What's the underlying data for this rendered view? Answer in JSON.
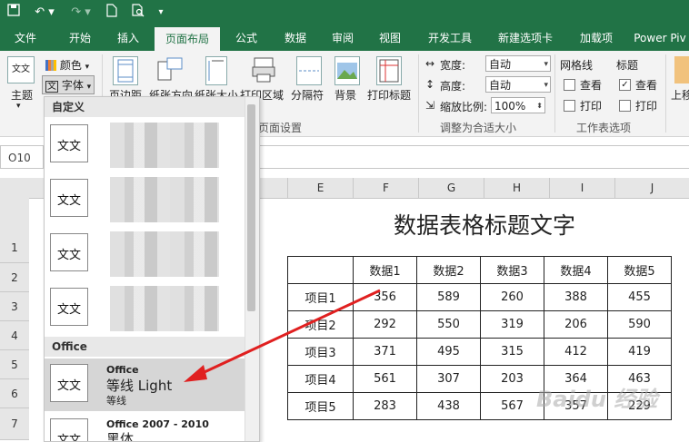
{
  "titlebar": {
    "icons": [
      "save-icon",
      "undo-icon",
      "redo-icon",
      "new-file-icon",
      "print-preview-icon",
      "customize-icon"
    ],
    "bg_color": "#217346"
  },
  "tabs": [
    {
      "label": "文件"
    },
    {
      "label": "开始"
    },
    {
      "label": "插入"
    },
    {
      "label": "页面布局",
      "active": true
    },
    {
      "label": "公式"
    },
    {
      "label": "数据"
    },
    {
      "label": "审阅"
    },
    {
      "label": "视图"
    },
    {
      "label": "开发工具"
    },
    {
      "label": "新建选项卡"
    },
    {
      "label": "加载项"
    },
    {
      "label": "Power Piv"
    }
  ],
  "ribbon": {
    "theme": {
      "main": "主题",
      "colors": "颜色",
      "fonts": "字体"
    },
    "margins": "页边距",
    "orientation": "纸张方向",
    "size": "纸张大小",
    "print_area": "打印区域",
    "breaks": "分隔符",
    "background": "背景",
    "print_titles": "打印标题",
    "page_setup_group": "页面设置",
    "scale": {
      "width_label": "宽度:",
      "width_value": "自动",
      "height_label": "高度:",
      "height_value": "自动",
      "scale_label": "缩放比例:",
      "scale_value": "100%",
      "group": "调整为合适大小"
    },
    "sheet_options": {
      "gridlines": "网格线",
      "headings": "标题",
      "view": "查看",
      "print": "打印",
      "gridlines_view": false,
      "gridlines_print": false,
      "headings_view": true,
      "headings_print": false,
      "group": "工作表选项"
    },
    "bring_forward": "上移"
  },
  "namebox": "O10",
  "dropdown": {
    "custom_header": "自定义",
    "custom_items": [
      "文文",
      "文文",
      "文文",
      "文文"
    ],
    "office_header": "Office",
    "office_items": [
      {
        "theme": "Office",
        "heading_font": "等线 Light",
        "body_font": "等线",
        "icon": "文文"
      },
      {
        "theme": "Office 2007 - 2010",
        "heading_font": "黑体",
        "icon": "文文"
      }
    ]
  },
  "grid": {
    "columns": [
      "E",
      "F",
      "G",
      "H",
      "I",
      "J"
    ],
    "rows": [
      "1",
      "2",
      "3",
      "4",
      "5",
      "6",
      "7"
    ]
  },
  "sheet": {
    "title": "数据表格标题文字",
    "headers": [
      "",
      "数据1",
      "数据2",
      "数据3",
      "数据4",
      "数据5"
    ],
    "rows": [
      {
        "label": "项目1",
        "values": [
          "356",
          "589",
          "260",
          "388",
          "455"
        ]
      },
      {
        "label": "项目2",
        "values": [
          "292",
          "550",
          "319",
          "206",
          "590"
        ]
      },
      {
        "label": "项目3",
        "values": [
          "371",
          "495",
          "315",
          "412",
          "419"
        ]
      },
      {
        "label": "项目4",
        "values": [
          "561",
          "307",
          "203",
          "364",
          "463"
        ]
      },
      {
        "label": "项目5",
        "values": [
          "283",
          "438",
          "567",
          "357",
          "229"
        ]
      }
    ]
  },
  "annotation": {
    "arrow_color": "#e02020"
  },
  "watermark": "Baidu 经验"
}
